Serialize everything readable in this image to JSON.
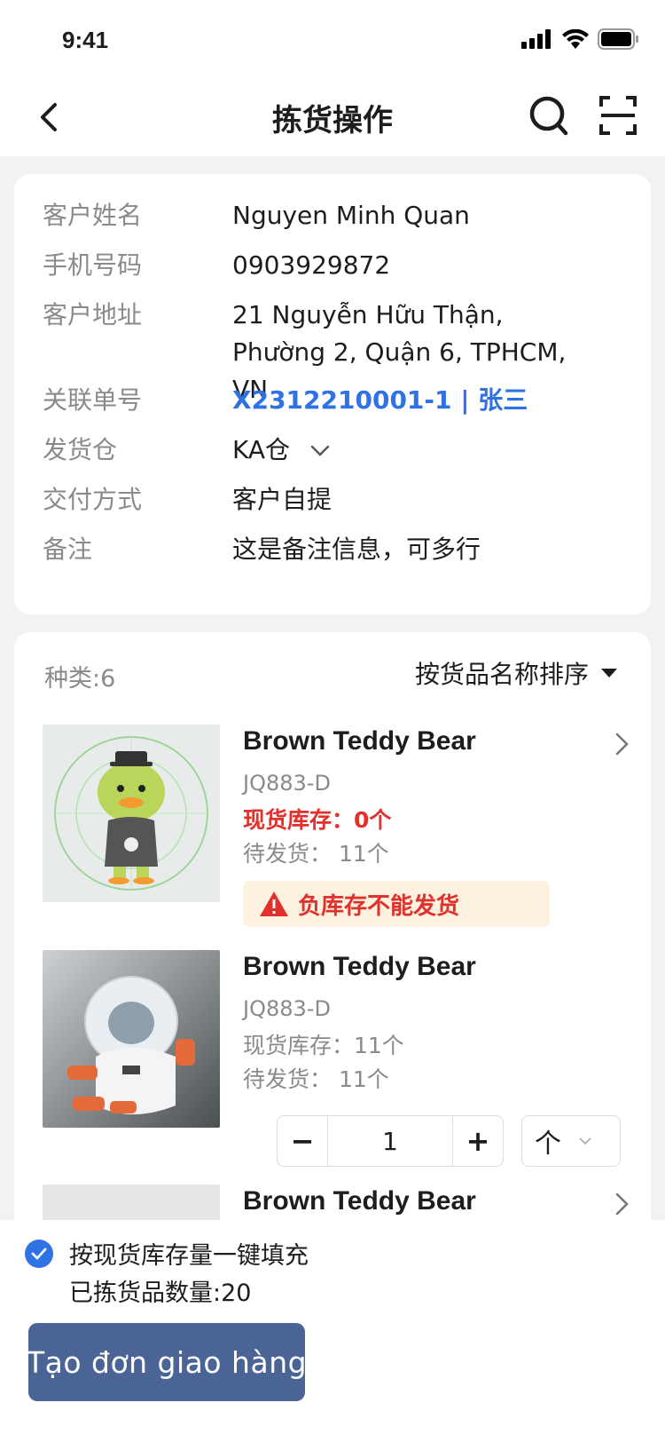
{
  "status_bar": {
    "time": "9:41"
  },
  "nav": {
    "title": "拣货操作"
  },
  "customer": {
    "rows": [
      {
        "label": "客户姓名",
        "value": "Nguyen Minh Quan"
      },
      {
        "label": "手机号码",
        "value": "0903929872"
      },
      {
        "label": "客户地址",
        "value": "21 Nguyễn Hữu Thận, Phường 2, Quận 6, TPHCM, VN"
      },
      {
        "label": "关联单号",
        "value": "X2312210001-1 | 张三"
      },
      {
        "label": "发货仓",
        "value": "KA仓"
      },
      {
        "label": "交付方式",
        "value": "客户自提"
      },
      {
        "label": "备注",
        "value": "这是备注信息，可多行"
      }
    ]
  },
  "goods": {
    "category_count": "种类:6",
    "sort_label": "按货品名称排序",
    "items": [
      {
        "title": "Brown Teddy Bear",
        "code": "JQ883-D",
        "stock": "现货库存：0个",
        "pending": "待发货： 11个",
        "warning": "负库存不能发货"
      },
      {
        "title": "Brown Teddy Bear",
        "code": "JQ883-D",
        "stock": "现货库存：11个",
        "pending": "待发货： 11个",
        "quantity": "1",
        "unit": "个"
      },
      {
        "title": "Brown Teddy Bear"
      }
    ]
  },
  "bottom": {
    "fill_label": "按现货库存量一键填充",
    "picked_count": "已拣货品数量:20",
    "create_button": "Tạo đơn giao hàng"
  },
  "colors": {
    "accent": "#2f72e4",
    "danger": "#e0312c",
    "warning_bg": "#fdf1e0",
    "primary_button": "#4a6496"
  }
}
